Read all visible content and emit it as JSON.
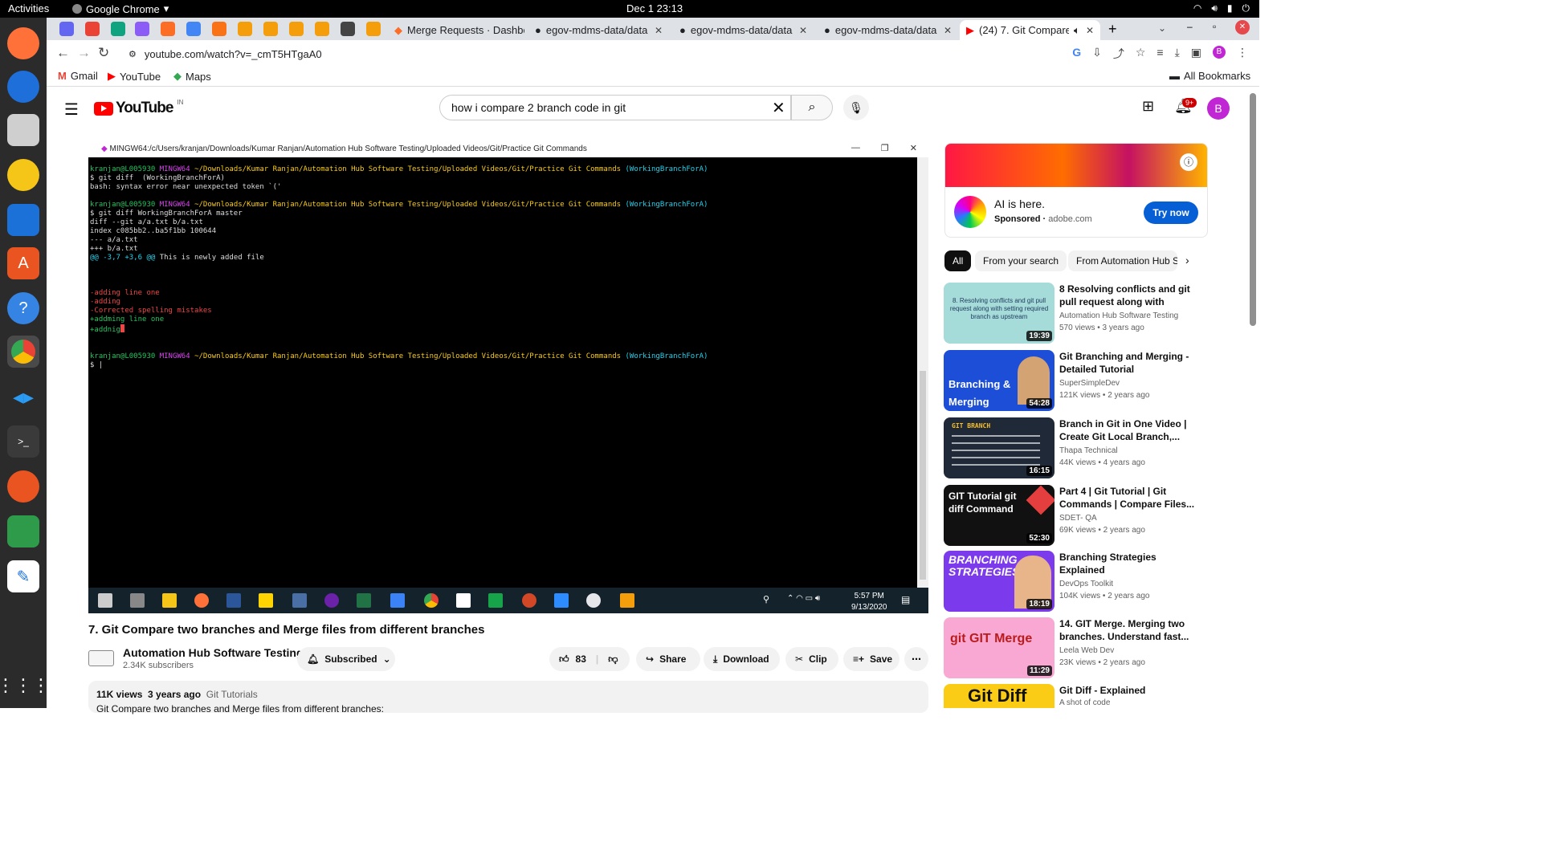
{
  "os": {
    "activities": "Activities",
    "app_name": "Google Chrome",
    "clock": "Dec 1  23:13"
  },
  "tabs": [
    {
      "label": "Merge Requests · Dashboard"
    },
    {
      "label": "egov-mdms-data/data"
    },
    {
      "label": "egov-mdms-data/data"
    },
    {
      "label": "egov-mdms-data/data"
    },
    {
      "label": "(24) 7. Git Compare two branches"
    }
  ],
  "omnibox": {
    "url": "youtube.com/watch?v=_cmT5HTgaA0"
  },
  "bookmarks": {
    "gmail": "Gmail",
    "youtube": "YouTube",
    "maps": "Maps",
    "all": "All Bookmarks"
  },
  "youtube": {
    "region": "IN",
    "search_query": "how i compare 2 branch code in git",
    "notif_count": "9+",
    "avatar_letter": "B"
  },
  "terminal": {
    "window_title": "MINGW64:/c/Users/kranjan/Downloads/Kumar Ranjan/Automation Hub Software Testing/Uploaded Videos/Git/Practice Git Commands",
    "user_host": "kranjan@L005930",
    "env": "MINGW64",
    "path": "~/Downloads/Kumar Ranjan/Automation Hub Software Testing/Uploaded Videos/Git/Practice Git Commands",
    "branch": "(WorkingBranchForA)",
    "cmd1": "$ git diff  (WorkingBranchForA)",
    "err1": "bash: syntax error near unexpected token `('",
    "cmd2": "$ git diff WorkingBranchForA master",
    "diff1": "diff --git a/a.txt b/a.txt",
    "diff2": "index c085bb2..ba5f1bb 100644",
    "diff3": "--- a/a.txt",
    "diff4": "+++ b/a.txt",
    "hunk": "@@ -3,7 +3,6 @@",
    "hunk_ctx": " This is newly added file",
    "rm1": "-adding line one",
    "rm2": "-adding",
    "rm3": "-Corrected spelling mistakes",
    "add1": "+addming line one",
    "add2": "+addnig",
    "prompt_end": "$ |"
  },
  "win_taskbar": {
    "time": "5:57 PM",
    "date": "9/13/2020"
  },
  "video": {
    "title": "7. Git Compare two branches and Merge files from different branches",
    "channel": "Automation Hub Software Testing",
    "subscribers": "2.34K subscribers",
    "subscribed_label": "Subscribed",
    "likes": "83",
    "share": "Share",
    "download": "Download",
    "clip": "Clip",
    "save": "Save",
    "views": "11K views",
    "age": "3 years ago",
    "tag": "Git Tutorials",
    "desc_line": "Git Compare two branches and Merge files from different branches:"
  },
  "ad": {
    "headline": "AI is here.",
    "sponsored": "Sponsored",
    "domain": "adobe.com",
    "cta": "Try now"
  },
  "chips": [
    {
      "label": "All"
    },
    {
      "label": "From your search"
    },
    {
      "label": "From Automation Hub Software Testing"
    }
  ],
  "recommendations": [
    {
      "title": "8 Resolving conflicts and git pull request along with setting...",
      "channel": "Automation Hub Software Testing",
      "meta": "570 views • 3 years ago",
      "duration": "19:39",
      "thumb_text": "8. Resolving conflicts and git pull request along with setting required branch as upstream"
    },
    {
      "title": "Git Branching and Merging - Detailed Tutorial",
      "channel": "SuperSimpleDev",
      "meta": "121K views • 2 years ago",
      "duration": "54:28",
      "thumb_text": "Branching & Merging"
    },
    {
      "title": "Branch in Git in One Video | Create Git Local Branch,...",
      "channel": "Thapa Technical",
      "meta": "44K views • 4 years ago",
      "duration": "16:15",
      "thumb_text": "GIT BRANCH"
    },
    {
      "title": "Part 4 | Git Tutorial | Git Commands | Compare Files...",
      "channel": "SDET- QA",
      "meta": "69K views • 2 years ago",
      "duration": "52:30",
      "thumb_text": "GIT Tutorial git diff Command"
    },
    {
      "title": "Branching Strategies Explained",
      "channel": "DevOps Toolkit",
      "meta": "104K views • 2 years ago",
      "duration": "18:19",
      "thumb_text": "BRANCHING STRATEGIES"
    },
    {
      "title": "14. GIT Merge. Merging two branches. Understand fast...",
      "channel": "Leela Web Dev",
      "meta": "23K views • 2 years ago",
      "duration": "11:29",
      "thumb_text": "git GIT Merge"
    },
    {
      "title": "Git Diff - Explained",
      "channel": "A shot of code",
      "meta": "",
      "duration": "",
      "thumb_text": "Git Diff"
    }
  ]
}
